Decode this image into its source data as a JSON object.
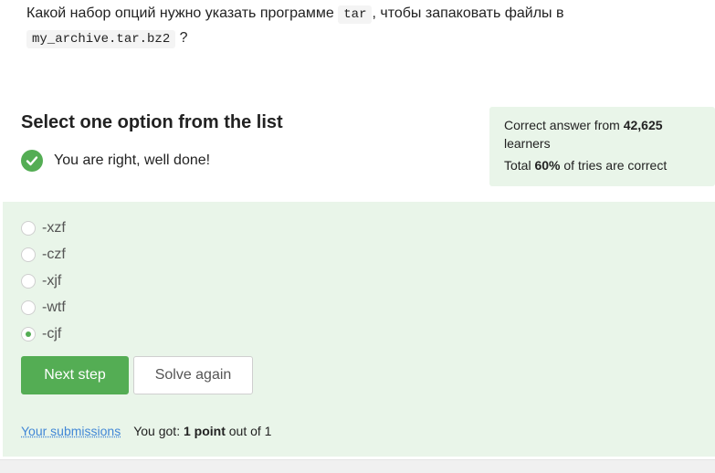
{
  "question": {
    "text_before": "Какой набор опций нужно указать программе ",
    "code1": "tar",
    "text_middle": ", чтобы запаковать файлы в ",
    "code2": "my_archive.tar.bz2",
    "text_after": " ?"
  },
  "select_title": "Select one option from the list",
  "result": {
    "icon": "check-circle-icon",
    "text": "You are right, well done!"
  },
  "stats": {
    "correct_prefix": "Correct answer from ",
    "learners_count": "42,625",
    "learners_suffix": "learners",
    "total_prefix": "Total ",
    "percent": "60%",
    "total_suffix": " of tries are correct"
  },
  "options": [
    {
      "label": "-xzf",
      "selected": false
    },
    {
      "label": "-czf",
      "selected": false
    },
    {
      "label": "-xjf",
      "selected": false
    },
    {
      "label": "-wtf",
      "selected": false
    },
    {
      "label": "-cjf",
      "selected": true
    }
  ],
  "buttons": {
    "next_step": "Next step",
    "solve_again": "Solve again"
  },
  "footer": {
    "submissions_link": "Your submissions",
    "score_prefix": "You got: ",
    "score_points": "1 point",
    "score_suffix": " out of 1"
  },
  "colors": {
    "accent_green": "#54ad54",
    "panel_bg": "#e9f5e9",
    "link_blue": "#4187d6"
  }
}
